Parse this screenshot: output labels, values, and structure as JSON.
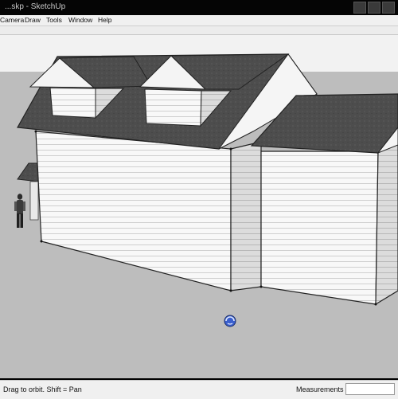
{
  "window": {
    "title": "...skp - SketchUp"
  },
  "menu": {
    "items": [
      "Camera",
      "Draw",
      "Tools",
      "Window",
      "Help"
    ]
  },
  "status": {
    "hint": "Drag to orbit.  Shift = Pan",
    "measurements_label": "Measurements",
    "measurements_value": ""
  },
  "colors": {
    "ground": "#bdbdbd",
    "sky": "#f2f2f2",
    "roof": "#4a4a4a",
    "siding": "#f7f7f7"
  },
  "icons": [
    "orbit-cursor-icon",
    "human-figure-icon"
  ]
}
